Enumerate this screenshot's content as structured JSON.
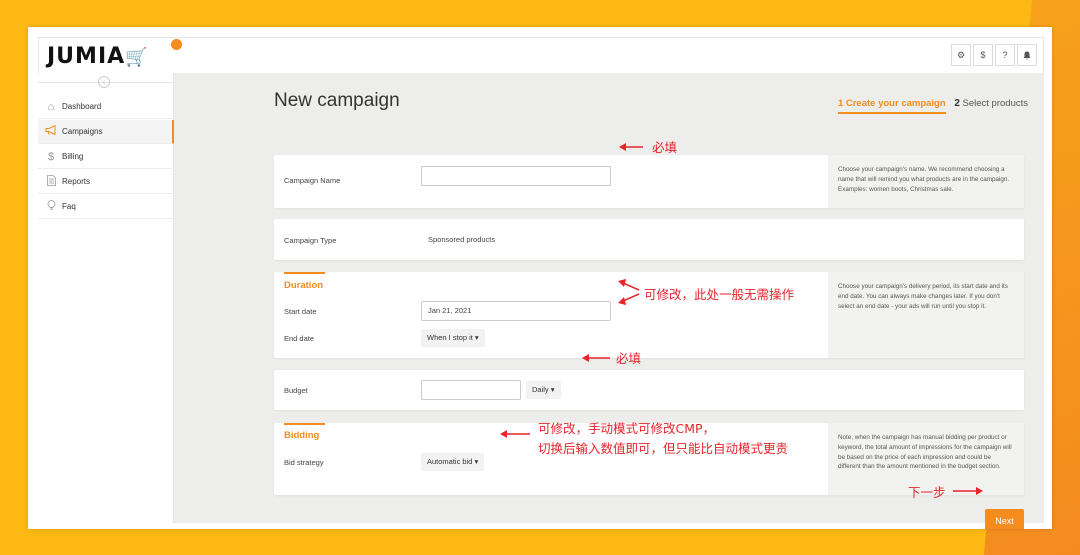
{
  "app": {
    "logo_text": "JUMIA",
    "top_icons": [
      "gear-icon",
      "dollar-icon",
      "help-icon",
      "bell-icon"
    ],
    "top_icon_glyphs": [
      "⚙",
      "$",
      "?",
      "🔔"
    ]
  },
  "sidebar": {
    "items": [
      {
        "label": "Dashboard",
        "icon": "home-icon",
        "glyph": "⌂"
      },
      {
        "label": "Campaigns",
        "icon": "megaphone-icon",
        "glyph": "📢",
        "active": true
      },
      {
        "label": "Billing",
        "icon": "dollar-icon",
        "glyph": "$"
      },
      {
        "label": "Reports",
        "icon": "document-icon",
        "glyph": "🗎"
      },
      {
        "label": "Faq",
        "icon": "bulb-icon",
        "glyph": "💡"
      }
    ]
  },
  "page": {
    "title": "New campaign",
    "step1": "1 Create your campaign",
    "step2_num": "2",
    "step2_label": "Select products"
  },
  "form": {
    "campaign_name": {
      "label": "Campaign Name",
      "value": "",
      "help": "Choose your campaign's name. We recommend choosing a name that will remind you what products are in the campaign. Examples: women boots, Christmas sale."
    },
    "campaign_type": {
      "label": "Campaign Type",
      "value": "Sponsored products"
    },
    "duration": {
      "title": "Duration",
      "start_label": "Start date",
      "start_value": "Jan 21, 2021",
      "end_label": "End date",
      "end_value": "When I stop it ▾",
      "help": "Choose your campaign's delivery period, its start date and its end date. You can always make changes later. If you don't select an end date - your ads will run until you stop it."
    },
    "budget": {
      "label": "Budget",
      "value": "",
      "period": "Daily ▾"
    },
    "bidding": {
      "title": "Bidding",
      "strategy_label": "Bid strategy",
      "strategy_value": "Automatic bid ▾",
      "help": "Note, when the campaign has manual bidding per product or keyword, the total amount of impressions for the campaign will be based on the price of each impression and could be different than the amount mentioned in the budget section."
    },
    "next_label": "Next"
  },
  "annotations": {
    "name_required": "必填",
    "duration_note": "可修改，此处一般无需操作",
    "budget_required": "必填",
    "bidding_note_line1": "可修改，手动模式可修改CMP，",
    "bidding_note_line2": "切换后输入数值即可，但只能比自动模式更贵",
    "next_note": "下一步",
    "color": "#e8232a"
  },
  "colors": {
    "brand": "#f68b1e",
    "background": "#fdb813"
  }
}
